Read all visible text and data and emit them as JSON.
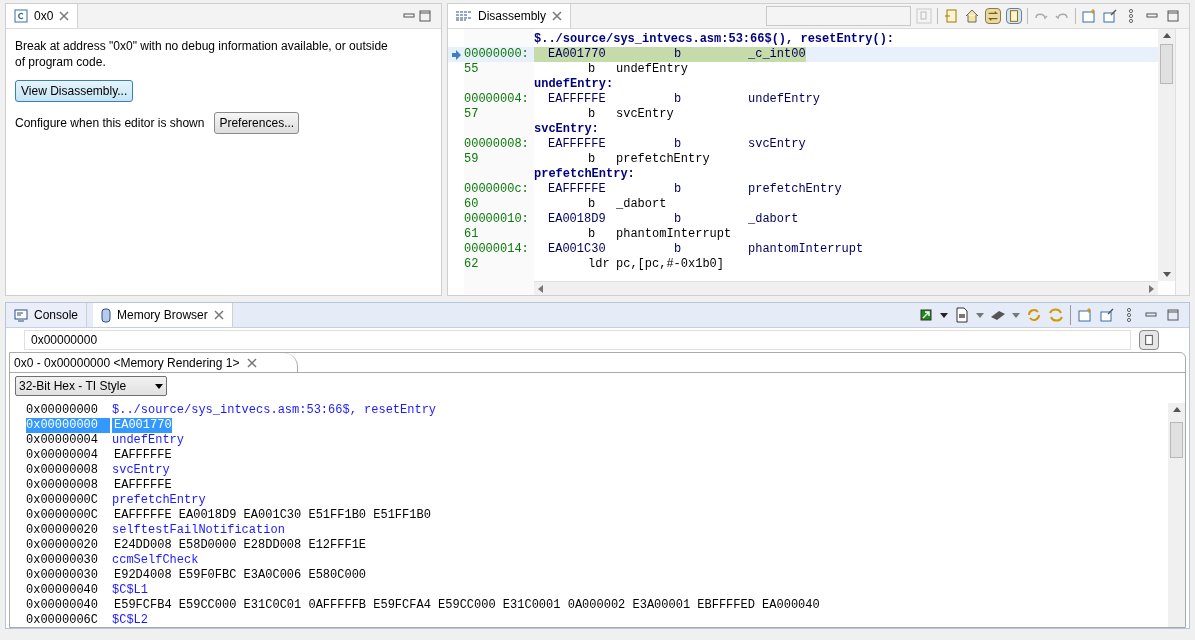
{
  "editor": {
    "tab": {
      "label": "0x0",
      "selected": true
    },
    "message": "Break at address \"0x0\" with no debug information available, or outside of program code.",
    "view_button": "View Disassembly...",
    "configure_text": "Configure when this editor is shown",
    "preferences_button": "Preferences..."
  },
  "disassembly": {
    "tab": {
      "label": "Disassembly",
      "selected": true
    },
    "rows": [
      {
        "kind": "header",
        "text": "$../source/sys_intvecs.asm:53:66$(), resetEntry():"
      },
      {
        "kind": "instr",
        "address": "00000000:",
        "opcode": "EA001770",
        "mnemonic": "b",
        "operand": "_c_int00",
        "current": true
      },
      {
        "kind": "source",
        "line": "55",
        "mnemonic": "b",
        "operand": "undefEntry"
      },
      {
        "kind": "header",
        "text": "undefEntry:"
      },
      {
        "kind": "instr",
        "address": "00000004:",
        "opcode": "EAFFFFFE",
        "mnemonic": "b",
        "operand": "undefEntry",
        "current": false
      },
      {
        "kind": "source",
        "line": "57",
        "mnemonic": "b",
        "operand": "svcEntry"
      },
      {
        "kind": "header",
        "text": "svcEntry:"
      },
      {
        "kind": "instr",
        "address": "00000008:",
        "opcode": "EAFFFFFE",
        "mnemonic": "b",
        "operand": "svcEntry",
        "current": false
      },
      {
        "kind": "source",
        "line": "59",
        "mnemonic": "b",
        "operand": "prefetchEntry"
      },
      {
        "kind": "header",
        "text": "prefetchEntry:"
      },
      {
        "kind": "instr",
        "address": "0000000c:",
        "opcode": "EAFFFFFE",
        "mnemonic": "b",
        "operand": "prefetchEntry",
        "current": false
      },
      {
        "kind": "source",
        "line": "60",
        "mnemonic": "b",
        "operand": "_dabort"
      },
      {
        "kind": "instr",
        "address": "00000010:",
        "opcode": "EA0018D9",
        "mnemonic": "b",
        "operand": "_dabort",
        "current": false
      },
      {
        "kind": "source",
        "line": "61",
        "mnemonic": "b",
        "operand": "phantomInterrupt"
      },
      {
        "kind": "instr",
        "address": "00000014:",
        "opcode": "EA001C30",
        "mnemonic": "b",
        "operand": "phantomInterrupt",
        "current": false
      },
      {
        "kind": "source",
        "line": "62",
        "mnemonic": "ldr",
        "operand": "pc,[pc,#-0x1b0]"
      }
    ]
  },
  "bottom_tabs": [
    {
      "label": "Console",
      "selected": false,
      "kind": "console"
    },
    {
      "label": "Memory Browser",
      "selected": true,
      "kind": "memory"
    }
  ],
  "memory": {
    "address_field": "0x00000000",
    "rendering_tab": "0x0 - 0x00000000 <Memory Rendering 1>",
    "format": "32-Bit Hex - TI Style",
    "rows": [
      {
        "kind": "label",
        "address": "0x00000000",
        "text": "$../source/sys_intvecs.asm:53:66$, resetEntry",
        "selected": false
      },
      {
        "kind": "data",
        "address": "0x00000000",
        "text": "EA001770",
        "selected": true
      },
      {
        "kind": "label",
        "address": "0x00000004",
        "text": "undefEntry",
        "selected": false
      },
      {
        "kind": "data",
        "address": "0x00000004",
        "text": "EAFFFFFE",
        "selected": false
      },
      {
        "kind": "label",
        "address": "0x00000008",
        "text": "svcEntry",
        "selected": false
      },
      {
        "kind": "data",
        "address": "0x00000008",
        "text": "EAFFFFFE",
        "selected": false
      },
      {
        "kind": "label",
        "address": "0x0000000C",
        "text": "prefetchEntry",
        "selected": false
      },
      {
        "kind": "data",
        "address": "0x0000000C",
        "text": "EAFFFFFE EA0018D9 EA001C30 E51FF1B0 E51FF1B0",
        "selected": false
      },
      {
        "kind": "label",
        "address": "0x00000020",
        "text": "selftestFailNotification",
        "selected": false
      },
      {
        "kind": "data",
        "address": "0x00000020",
        "text": "E24DD008 E58D0000 E28DD008 E12FFF1E",
        "selected": false
      },
      {
        "kind": "label",
        "address": "0x00000030",
        "text": "ccmSelfCheck",
        "selected": false
      },
      {
        "kind": "data",
        "address": "0x00000030",
        "text": "E92D4008 E59F0FBC E3A0C006 E580C000",
        "selected": false
      },
      {
        "kind": "label",
        "address": "0x00000040",
        "text": "$C$L1",
        "selected": false
      },
      {
        "kind": "data",
        "address": "0x00000040",
        "text": "E59FCFB4 E59CC000 E31C0C01 0AFFFFFB E59FCFA4 E59CC000 E31C0001 0A000002 E3A00001 EBFFFFED EA000040",
        "selected": false
      },
      {
        "kind": "label",
        "address": "0x0000006C",
        "text": "$C$L2",
        "selected": false
      }
    ]
  }
}
